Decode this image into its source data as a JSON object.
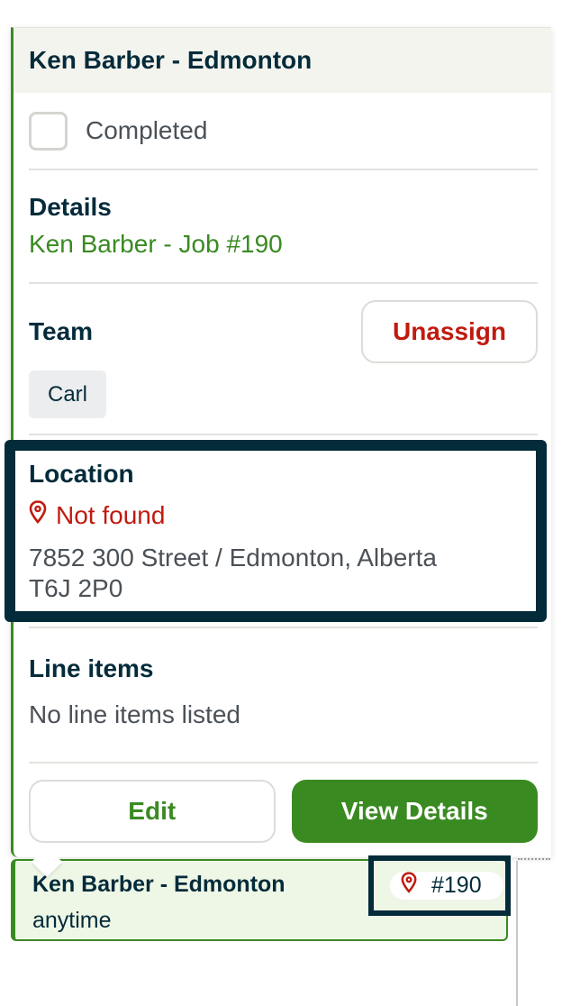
{
  "popover": {
    "title": "Ken Barber - Edmonton",
    "completed_label": "Completed",
    "details": {
      "heading": "Details",
      "client_link": "Ken Barber",
      "separator": "-",
      "job_link": "Job #190"
    },
    "team": {
      "heading": "Team",
      "unassign_label": "Unassign",
      "members": [
        "Carl"
      ]
    },
    "location": {
      "heading": "Location",
      "status_icon": "map-pin-icon",
      "status_text": "Not found",
      "address_line1": "7852 300 Street / Edmonton, Alberta",
      "address_line2": "T6J 2P0"
    },
    "line_items": {
      "heading": "Line items",
      "empty_text": "No line items listed"
    },
    "actions": {
      "edit_label": "Edit",
      "view_details_label": "View Details"
    }
  },
  "event": {
    "title": "Ken Barber - Edmonton",
    "time": "anytime",
    "badge_icon": "map-pin-icon",
    "badge_text": "#190"
  },
  "colors": {
    "brand_green": "#3a8a22",
    "error_red": "#c01a0f",
    "text_dark": "#032b3a",
    "highlight": "#032b3a"
  }
}
